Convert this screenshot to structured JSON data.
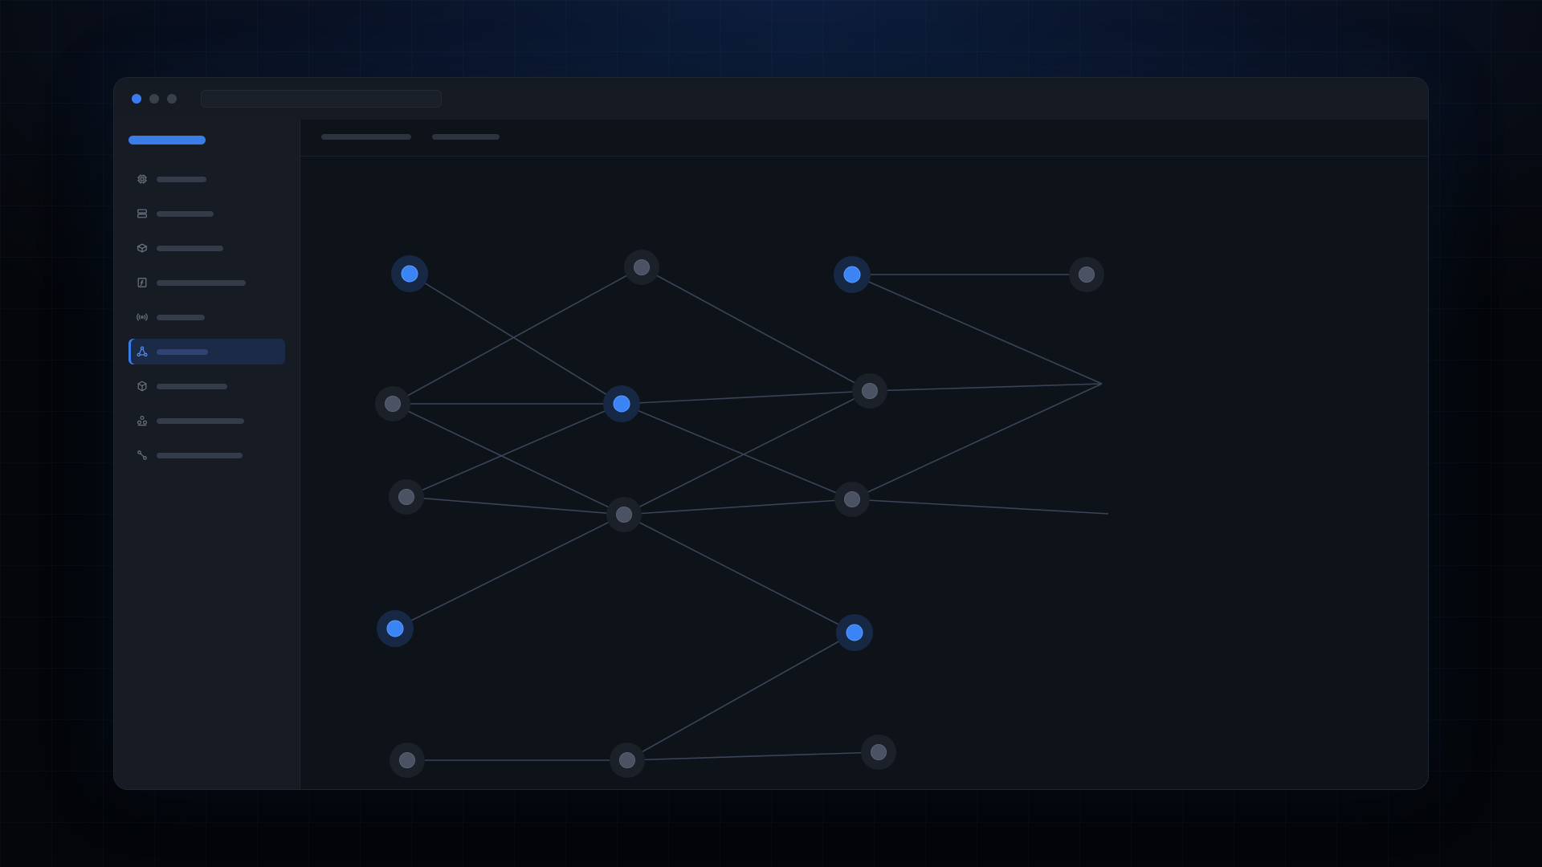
{
  "window": {
    "title": "",
    "url": ""
  },
  "colors": {
    "accent": "#3b84f5",
    "background": "#0e1219",
    "sidebar": "#161b24",
    "node_inactive": "#4a5263",
    "edge": "#3a4558"
  },
  "sidebar": {
    "brand": "",
    "items": [
      {
        "icon": "cpu-icon",
        "label": "",
        "active": false
      },
      {
        "icon": "server-icon",
        "label": "",
        "active": false
      },
      {
        "icon": "package-icon",
        "label": "",
        "active": false
      },
      {
        "icon": "function-icon",
        "label": "",
        "active": false
      },
      {
        "icon": "broadcast-icon",
        "label": "",
        "active": false
      },
      {
        "icon": "network-icon",
        "label": "",
        "active": true
      },
      {
        "icon": "cube-icon",
        "label": "",
        "active": false
      },
      {
        "icon": "cluster-icon",
        "label": "",
        "active": false
      },
      {
        "icon": "route-icon",
        "label": "",
        "active": false
      }
    ]
  },
  "main": {
    "tabs": [
      {
        "label": ""
      },
      {
        "label": ""
      }
    ]
  },
  "graph": {
    "nodes": [
      {
        "id": "n1",
        "state": "active"
      },
      {
        "id": "n2",
        "state": "inactive"
      },
      {
        "id": "n3",
        "state": "active"
      },
      {
        "id": "n4",
        "state": "inactive"
      },
      {
        "id": "n5",
        "state": "inactive"
      },
      {
        "id": "n6",
        "state": "active"
      },
      {
        "id": "n7",
        "state": "inactive"
      },
      {
        "id": "n8",
        "state": "inactive"
      },
      {
        "id": "n9",
        "state": "inactive"
      },
      {
        "id": "n10",
        "state": "inactive"
      },
      {
        "id": "n11",
        "state": "inactive"
      },
      {
        "id": "n12",
        "state": "active"
      },
      {
        "id": "n13",
        "state": "active"
      },
      {
        "id": "n14",
        "state": "inactive"
      },
      {
        "id": "n15",
        "state": "inactive"
      },
      {
        "id": "n16",
        "state": "inactive"
      },
      {
        "id": "j1",
        "state": "junction"
      },
      {
        "id": "j2",
        "state": "junction"
      }
    ],
    "edges": [
      [
        "n1",
        "n6"
      ],
      [
        "n5",
        "n2"
      ],
      [
        "n2",
        "n9"
      ],
      [
        "n3",
        "n4"
      ],
      [
        "n3",
        "j1"
      ],
      [
        "n5",
        "n6"
      ],
      [
        "n5",
        "n10"
      ],
      [
        "n8",
        "n6"
      ],
      [
        "n8",
        "n10"
      ],
      [
        "n6",
        "n9"
      ],
      [
        "n6",
        "n11"
      ],
      [
        "n9",
        "j1"
      ],
      [
        "n10",
        "n9"
      ],
      [
        "n10",
        "n11"
      ],
      [
        "n11",
        "j1"
      ],
      [
        "n11",
        "j2"
      ],
      [
        "n12",
        "n10"
      ],
      [
        "n10",
        "n13"
      ],
      [
        "n13",
        "n15"
      ],
      [
        "n14",
        "n15"
      ],
      [
        "n15",
        "n16"
      ]
    ]
  }
}
